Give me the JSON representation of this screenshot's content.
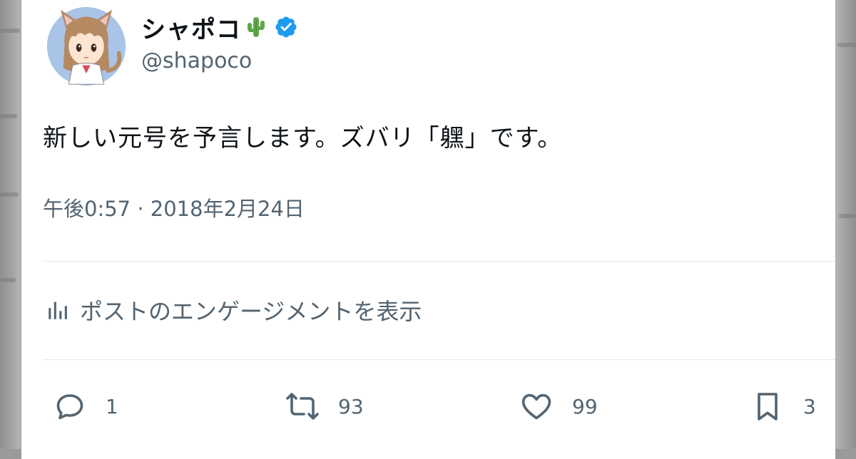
{
  "user": {
    "display_name": "シャポコ",
    "handle": "@shapoco",
    "verified": true,
    "emoji": "cactus-icon"
  },
  "tweet": {
    "text": "新しい元号を予言します。ズバリ「𨊂」です。",
    "timestamp": "午後0:57 · 2018年2月24日"
  },
  "engagement": {
    "label": "ポストのエンゲージメントを表示",
    "icon": "bar-chart-icon"
  },
  "actions": {
    "reply_count": "1",
    "retweet_count": "93",
    "like_count": "99",
    "bookmark_count": "3"
  },
  "colors": {
    "text_primary": "#0f1419",
    "text_secondary": "#536471",
    "verified_blue": "#1d9bf0",
    "divider": "#e7e9ea"
  }
}
